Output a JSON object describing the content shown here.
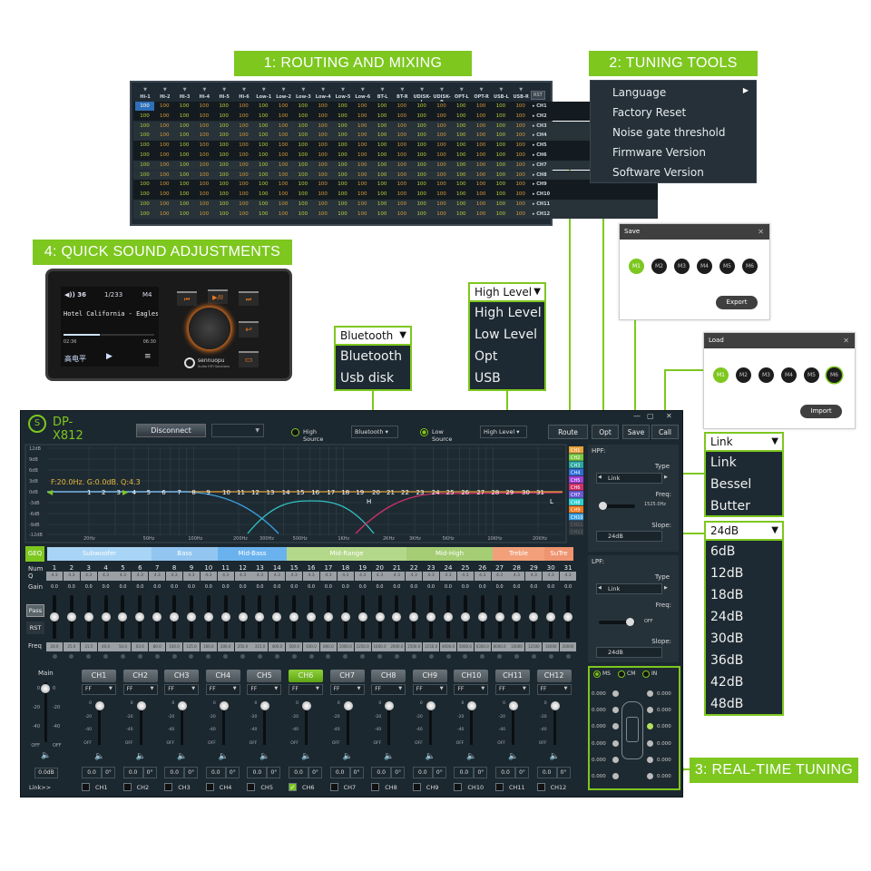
{
  "labels": {
    "routing": "1: ROUTING AND MIXING",
    "tuning": "2: TUNING TOOLS",
    "realtime": "3: REAL-TIME TUNING",
    "quick": "4: QUICK SOUND ADJUSTMENTS"
  },
  "matrix": {
    "inputs": [
      "Hi-1",
      "Hi-2",
      "Hi-3",
      "Hi-4",
      "Hi-5",
      "Hi-6",
      "Low-1",
      "Low-2",
      "Low-3",
      "Low-4",
      "Low-5",
      "Low-6",
      "BT-L",
      "BT-R",
      "UDISK-L",
      "UDISK-R",
      "OPT-L",
      "OPT-R",
      "USB-L",
      "USB-R"
    ],
    "outputs": [
      "CH1",
      "CH2",
      "CH3",
      "CH4",
      "CH5",
      "CH6",
      "CH7",
      "CH8",
      "CH9",
      "CH10",
      "CH11",
      "CH12"
    ],
    "rst": "RST",
    "values": [
      [
        100,
        100,
        100,
        100,
        100,
        100,
        100,
        100,
        100,
        100,
        100,
        100,
        100,
        100,
        100,
        100,
        100,
        100,
        100,
        100
      ],
      [
        100,
        100,
        100,
        100,
        100,
        100,
        100,
        100,
        100,
        100,
        100,
        100,
        100,
        100,
        100,
        100,
        100,
        100,
        100,
        100
      ],
      [
        100,
        100,
        100,
        100,
        100,
        100,
        100,
        100,
        100,
        100,
        100,
        100,
        100,
        100,
        100,
        100,
        100,
        100,
        100,
        100
      ],
      [
        100,
        100,
        100,
        100,
        100,
        100,
        100,
        100,
        100,
        100,
        100,
        100,
        100,
        100,
        100,
        100,
        100,
        100,
        100,
        100
      ],
      [
        100,
        100,
        100,
        100,
        100,
        100,
        100,
        100,
        100,
        100,
        100,
        100,
        100,
        100,
        100,
        100,
        100,
        100,
        100,
        100
      ],
      [
        100,
        100,
        100,
        100,
        100,
        100,
        100,
        100,
        100,
        100,
        100,
        100,
        100,
        100,
        100,
        100,
        100,
        100,
        100,
        100
      ],
      [
        100,
        100,
        100,
        100,
        100,
        100,
        100,
        100,
        100,
        100,
        100,
        100,
        100,
        100,
        100,
        100,
        100,
        100,
        100,
        100
      ],
      [
        100,
        100,
        100,
        100,
        100,
        100,
        100,
        100,
        100,
        100,
        100,
        100,
        100,
        100,
        100,
        100,
        100,
        100,
        100,
        100
      ],
      [
        100,
        100,
        100,
        100,
        100,
        100,
        100,
        100,
        100,
        100,
        100,
        100,
        100,
        100,
        100,
        100,
        100,
        100,
        100,
        100
      ],
      [
        100,
        100,
        100,
        100,
        100,
        100,
        100,
        100,
        100,
        100,
        100,
        100,
        100,
        100,
        100,
        100,
        100,
        100,
        100,
        100
      ],
      [
        100,
        100,
        100,
        100,
        100,
        100,
        100,
        100,
        100,
        100,
        100,
        100,
        100,
        100,
        100,
        100,
        100,
        100,
        100,
        100
      ],
      [
        100,
        100,
        100,
        100,
        100,
        100,
        100,
        100,
        100,
        100,
        100,
        100,
        100,
        100,
        100,
        100,
        100,
        100,
        100,
        100
      ]
    ]
  },
  "tools_menu": {
    "items": [
      "Language",
      "Factory Reset",
      "Noise gate threshold",
      "Firmware Version",
      "Software Version"
    ]
  },
  "save_dialog": {
    "title": "Save",
    "slots": [
      "M1",
      "M2",
      "M3",
      "M4",
      "M5",
      "M6"
    ],
    "button": "Export"
  },
  "load_dialog": {
    "title": "Load",
    "slots": [
      "M1",
      "M2",
      "M3",
      "M4",
      "M5",
      "M6"
    ],
    "button": "Import"
  },
  "device": {
    "volume": "36",
    "track": "1/233",
    "mode": "M4",
    "song": "Hotel California - Eagles",
    "elapsed": "02:36",
    "total": "06:30",
    "source": "高电平",
    "progress": 0.4,
    "brand": "sennuopu",
    "tagline": "Audio HIFI Solutions"
  },
  "bt_dropdown": {
    "selected": "Bluetooth",
    "options": [
      "Bluetooth",
      "Usb disk"
    ]
  },
  "hl_dropdown": {
    "selected": "High Level",
    "options": [
      "High Level",
      "Low Level",
      "Opt",
      "USB"
    ]
  },
  "type_dropdown": {
    "selected": "Link",
    "options": [
      "Link",
      "Bessel",
      "Butter"
    ]
  },
  "slope_dropdown": {
    "selected": "24dB",
    "options": [
      "6dB",
      "12dB",
      "18dB",
      "24dB",
      "30dB",
      "36dB",
      "42dB",
      "48dB"
    ]
  },
  "app": {
    "title": "DP-X812",
    "disconnect": "Disconnect",
    "high_source": "High Source",
    "high_source_value": "Bluetooth",
    "low_source": "Low Source",
    "low_source_value": "High Level",
    "buttons": [
      "Route",
      "Opt",
      "Save",
      "Call"
    ]
  },
  "graph": {
    "db_labels": [
      "12dB",
      "9dB",
      "6dB",
      "3dB",
      "0dB",
      "-3dB",
      "-6dB",
      "-9dB",
      "-12dB"
    ],
    "freq_labels": [
      "20Hz",
      "50Hz",
      "100Hz",
      "200Hz",
      "300Hz",
      "500Hz",
      "1KHz",
      "2KHz",
      "3KHz",
      "5KHz",
      "10KHz",
      "20KHz"
    ],
    "readout": "F:20.0Hz. G:0.0dB. Q:4.3",
    "h_marker": "H",
    "l_marker": "L",
    "channels": [
      {
        "name": "CH1",
        "color": "#e8a33a"
      },
      {
        "name": "CH2",
        "color": "#7ac943"
      },
      {
        "name": "CH3",
        "color": "#2aa6a0"
      },
      {
        "name": "CH4",
        "color": "#2e6fd8"
      },
      {
        "name": "CH5",
        "color": "#a040d8"
      },
      {
        "name": "CH6",
        "color": "#d0306a"
      },
      {
        "name": "CH7",
        "color": "#6a5ad8"
      },
      {
        "name": "CH8",
        "color": "#30d0d0"
      },
      {
        "name": "CH9",
        "color": "#f07a20"
      },
      {
        "name": "CH10",
        "color": "#3aa0e0"
      },
      {
        "name": "CH11",
        "color": "#333c42"
      },
      {
        "name": "CH12",
        "color": "#333c42"
      }
    ]
  },
  "hpf": {
    "title": "HPF:",
    "type_label": "Type",
    "type": "Link",
    "freq_label": "Freq:",
    "freq": "1525.0Hz",
    "slope_label": "Slope:",
    "slope": "24dB"
  },
  "lpf": {
    "title": "LPF:",
    "type_label": "Type",
    "type": "Link",
    "freq_label": "Freq:",
    "freq": "OFF",
    "slope_label": "Slope:",
    "slope": "24dB"
  },
  "geq": {
    "label": "GEQ",
    "bands": [
      "Subwoofer",
      "Bass",
      "Mid-Bass",
      "Mid-Range",
      "Mid-High",
      "Treble",
      "SuTre"
    ],
    "num_label": "Num",
    "q_label": "Q",
    "gain_label": "Gain",
    "freq_label": "Freq",
    "pass": "Pass",
    "rst": "RST",
    "freqs": [
      "20.0",
      "25.0",
      "31.5",
      "40.0",
      "50.0",
      "63.0",
      "80.0",
      "100.0",
      "125.0",
      "160.0",
      "200.0",
      "250.0",
      "315.0",
      "400.0",
      "500.0",
      "630.0",
      "800.0",
      "1000.0",
      "1250.0",
      "1600.0",
      "2000.0",
      "2500.0",
      "3150.0",
      "4000.0",
      "5000.0",
      "6300.0",
      "8000.0",
      "10000",
      "12500",
      "16000",
      "20000"
    ],
    "q": [
      "4.3",
      "4.3",
      "4.3",
      "4.3",
      "4.3",
      "4.3",
      "4.3",
      "4.3",
      "4.3",
      "4.3",
      "4.3",
      "4.3",
      "4.3",
      "4.3",
      "4.3",
      "4.3",
      "4.3",
      "4.3",
      "4.3",
      "4.3",
      "4.3",
      "4.3",
      "4.3",
      "4.3",
      "4.3",
      "4.3",
      "4.3",
      "4.3",
      "4.3",
      "4.3",
      "4.3"
    ],
    "gain": [
      "0.0",
      "0.0",
      "0.0",
      "0.0",
      "0.0",
      "0.0",
      "0.0",
      "0.0",
      "0.0",
      "0.0",
      "0.0",
      "0.0",
      "0.0",
      "0.0",
      "0.0",
      "0.0",
      "0.0",
      "0.0",
      "0.0",
      "0.0",
      "0.0",
      "0.0",
      "0.0",
      "0.0",
      "0.0",
      "0.0",
      "0.0",
      "0.0",
      "0.0",
      "0.0",
      "0.0"
    ]
  },
  "channels": {
    "main_label": "Main",
    "main_value": "0.0dB",
    "link": "Link>>",
    "scale": [
      "0",
      "-20",
      "-40",
      "OFF"
    ],
    "list": [
      {
        "name": "CH1",
        "filter": "FF",
        "gain": "0.0",
        "phase": "0°",
        "linked": false
      },
      {
        "name": "CH2",
        "filter": "FF",
        "gain": "0.0",
        "phase": "0°",
        "linked": false
      },
      {
        "name": "CH3",
        "filter": "FF",
        "gain": "0.0",
        "phase": "0°",
        "linked": false
      },
      {
        "name": "CH4",
        "filter": "FF",
        "gain": "0.0",
        "phase": "0°",
        "linked": false
      },
      {
        "name": "CH5",
        "filter": "FF",
        "gain": "0.0",
        "phase": "0°",
        "linked": false
      },
      {
        "name": "CH6",
        "filter": "FF",
        "gain": "0.0",
        "phase": "0°",
        "linked": true
      },
      {
        "name": "CH7",
        "filter": "FF",
        "gain": "0.0",
        "phase": "0°",
        "linked": false
      },
      {
        "name": "CH8",
        "filter": "FF",
        "gain": "0.0",
        "phase": "0°",
        "linked": false
      },
      {
        "name": "CH9",
        "filter": "FF",
        "gain": "0.0",
        "phase": "0°",
        "linked": false
      },
      {
        "name": "CH10",
        "filter": "FF",
        "gain": "0.0",
        "phase": "0°",
        "linked": false
      },
      {
        "name": "CH11",
        "filter": "FF",
        "gain": "0.0",
        "phase": "0°",
        "linked": false
      },
      {
        "name": "CH12",
        "filter": "FF",
        "gain": "0.0",
        "phase": "0°",
        "linked": false
      }
    ],
    "selected": "CH6"
  },
  "delay": {
    "modes": [
      "MS",
      "CM",
      "IN"
    ],
    "selected": "MS",
    "left": [
      "0.000",
      "0.000",
      "0.000",
      "0.000",
      "0.000",
      "0.000"
    ],
    "right": [
      "0.000",
      "0.000",
      "0.000",
      "0.000",
      "0.000",
      "0.000"
    ]
  }
}
